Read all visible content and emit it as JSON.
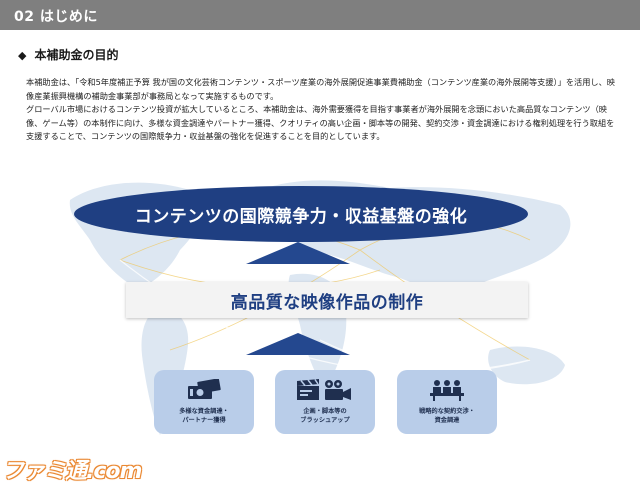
{
  "header": {
    "title": "02  はじめに",
    "bar_color": "#7f7f7f"
  },
  "section": {
    "bullet_icon": "diamond-icon",
    "heading": "本補助金の目的"
  },
  "intro": {
    "paragraph_1": "本補助金は、「令和5年度補正予算 我が国の文化芸術コンテンツ・スポーツ産業の海外展開促進事業費補助金（コンテンツ産業の海外展開等支援）」を活用し、映像産業振興機構の補助金事業部が事務局となって実施するものです。",
    "paragraph_2": "グローバル市場におけるコンテンツ投資が拡大しているところ、本補助金は、海外需要獲得を目指す事業者が海外展開を念頭においた高品質なコンテンツ（映像、ゲーム等）の本制作に向け、多様な資金調達やパートナー獲得、クオリティの高い企画・脚本等の開発、契約交渉・資金調達における権利処理を行う取組を支援することで、コンテンツの国際競争力・収益基盤の強化を促進することを目的としています。"
  },
  "diagram": {
    "goal": "コンテンツの国際競争力・収益基盤の強化",
    "production": "高品質な映像作品の制作",
    "cards": [
      {
        "icon": "money-icon",
        "label_line1": "多様な資金調達・",
        "label_line2": "パートナー獲得"
      },
      {
        "icon": "film-camera-icon",
        "label_line1": "企画・脚本等の",
        "label_line2": "ブラッシュアップ"
      },
      {
        "icon": "meeting-icon",
        "label_line1": "戦略的な契約交渉・",
        "label_line2": "資金調達"
      }
    ],
    "colors": {
      "primary": "#1f3f82",
      "card": "#b9cde9",
      "map": "#dde7f2"
    }
  },
  "watermark": {
    "text": "ファミ通.com"
  }
}
